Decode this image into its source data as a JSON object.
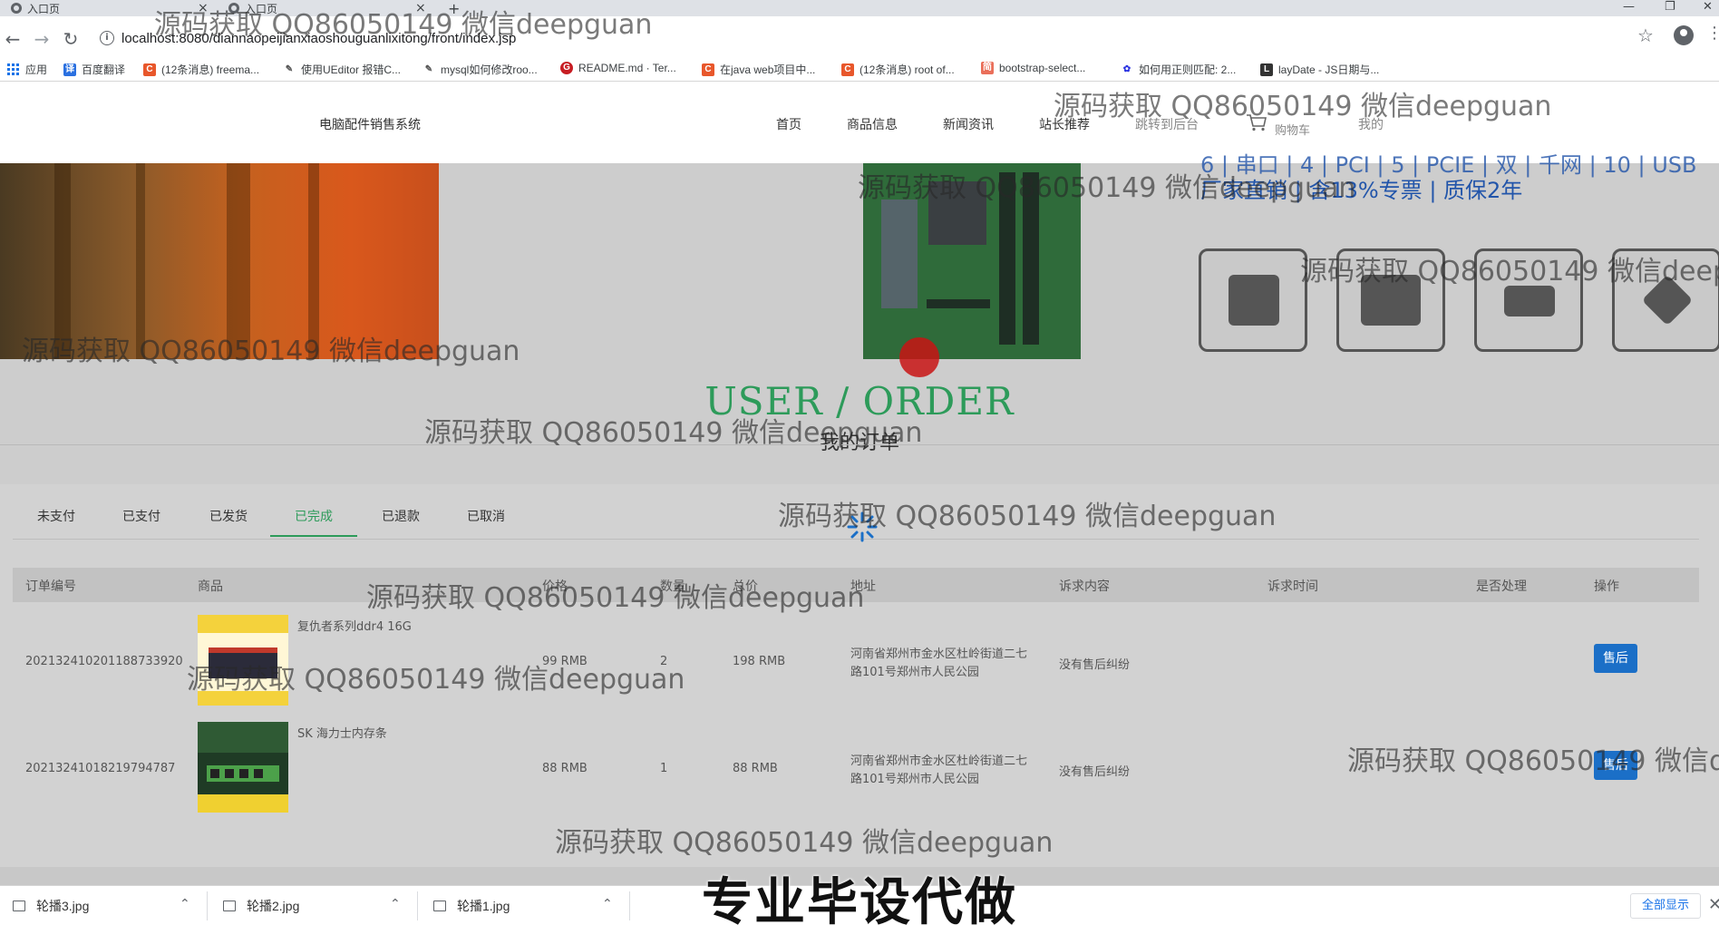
{
  "browser": {
    "tabs": [
      {
        "title": "入口页"
      },
      {
        "title": "入口页"
      }
    ],
    "new_tab": "+",
    "window_controls": [
      "—",
      "❐",
      "✕"
    ],
    "url": "localhost:8080/diannaopeijianxiaoshouguanlixitong/front/index.jsp",
    "bookmarks": [
      {
        "label": "应用",
        "icon": "apps-grid-icon",
        "color": "#1a73e8"
      },
      {
        "label": "百度翻译",
        "icon": "baidu-translate-icon",
        "color": "#2a70e0"
      },
      {
        "label": "(12条消息) freema...",
        "icon": "csdn-icon",
        "color": "#e8572b"
      },
      {
        "label": "使用UEditor 报错C...",
        "icon": "quill-icon",
        "color": "#555555"
      },
      {
        "label": "mysql如何修改roo...",
        "icon": "quill-icon",
        "color": "#555555"
      },
      {
        "label": "README.md · Ter...",
        "icon": "gitee-icon",
        "color": "#c71d23"
      },
      {
        "label": "在java web项目中...",
        "icon": "csdn-icon",
        "color": "#e8572b"
      },
      {
        "label": "(12条消息) root of...",
        "icon": "csdn-icon",
        "color": "#e8572b"
      },
      {
        "label": "bootstrap-select...",
        "icon": "jianshu-icon",
        "color": "#ea6f5a"
      },
      {
        "label": "如何用正则匹配: 2...",
        "icon": "baidu-paw-icon",
        "color": "#2932e1"
      },
      {
        "label": "layDate - JS日期与...",
        "icon": "layui-icon",
        "color": "#333333"
      }
    ]
  },
  "site": {
    "brand": "电脑配件销售系统",
    "nav": [
      "首页",
      "商品信息",
      "新闻资讯",
      "站长推荐",
      "跳转到后台",
      "购物车",
      "我的"
    ]
  },
  "banner": {
    "text_top": "6 | 串口 | 4 | PCI | 5 | PCIE | 双 | 千网 | 10 | USB",
    "text_main": "厂家直销 | 含13%专票 | 质保2年",
    "tiles": [
      "cpu-icon",
      "gpu-icon",
      "memory-icon",
      "compress-icon"
    ]
  },
  "section": {
    "title": "USER / ORDER",
    "subtitle": "我的订单"
  },
  "orders": {
    "status_tabs": [
      "未支付",
      "已支付",
      "已发货",
      "已完成",
      "已退款",
      "已取消"
    ],
    "active_tab": "已完成",
    "columns": [
      "订单编号",
      "商品",
      "价格",
      "数量",
      "总价",
      "地址",
      "诉求内容",
      "诉求时间",
      "是否处理",
      "操作"
    ],
    "rows": [
      {
        "order_no": "20213241020118873392​0",
        "product": "复仇者系列ddr4 16G",
        "price": "99 RMB",
        "qty": "2",
        "total": "198 RMB",
        "address": "河南省郑州市金水区杜岭街道二七路101号郑州市人民公园",
        "appeal": "没有售后纠纷",
        "appeal_time": "",
        "handled": "",
        "action": "售后"
      },
      {
        "order_no": "20213241018219794787",
        "product": "SK 海力士内存条",
        "price": "88 RMB",
        "qty": "1",
        "total": "88 RMB",
        "address": "河南省郑州市金水区杜岭街道二七路101号郑州市人民公园",
        "appeal": "没有售后纠纷",
        "appeal_time": "",
        "handled": "",
        "action": "售后"
      }
    ]
  },
  "downloads": {
    "files": [
      "轮播3.jpg",
      "轮播2.jpg",
      "轮播1.jpg"
    ],
    "show_all": "全部显示"
  },
  "watermark": "源码获取 QQ86050149 微信deepguan",
  "caption": "专业毕设代做",
  "colors": {
    "accent_green": "#2d9b5a",
    "button_blue": "#1b6fc7",
    "banner_blue_text": "#2255aa"
  }
}
